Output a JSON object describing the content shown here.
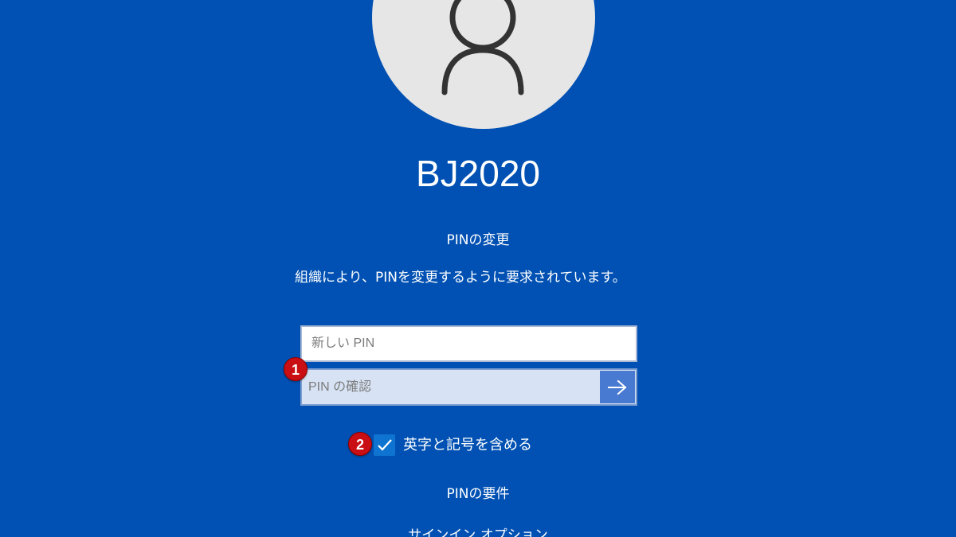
{
  "profile": {
    "username": "BJ2020",
    "avatar_icon": "user-icon"
  },
  "pin_change": {
    "title": "PINの変更",
    "message": "組織により、PINを変更するように要求されています。",
    "new_pin": {
      "placeholder": "新しい PIN",
      "value": ""
    },
    "confirm_pin": {
      "placeholder": "PIN の確認",
      "value": ""
    },
    "submit_icon": "arrow-right-icon"
  },
  "annotations": {
    "badge_1": "1",
    "badge_2": "2"
  },
  "options": {
    "include_symbols_label": "英字と記号を含める",
    "include_symbols_checked": true
  },
  "links": {
    "requirements": "PINの要件",
    "signin_options": "サインイン オプション"
  },
  "colors": {
    "background": "#0051b3",
    "avatar_background": "#e6e6e6",
    "submit_button": "#497ad2",
    "checkbox": "#0f74d1",
    "badge": "#c90f14"
  }
}
